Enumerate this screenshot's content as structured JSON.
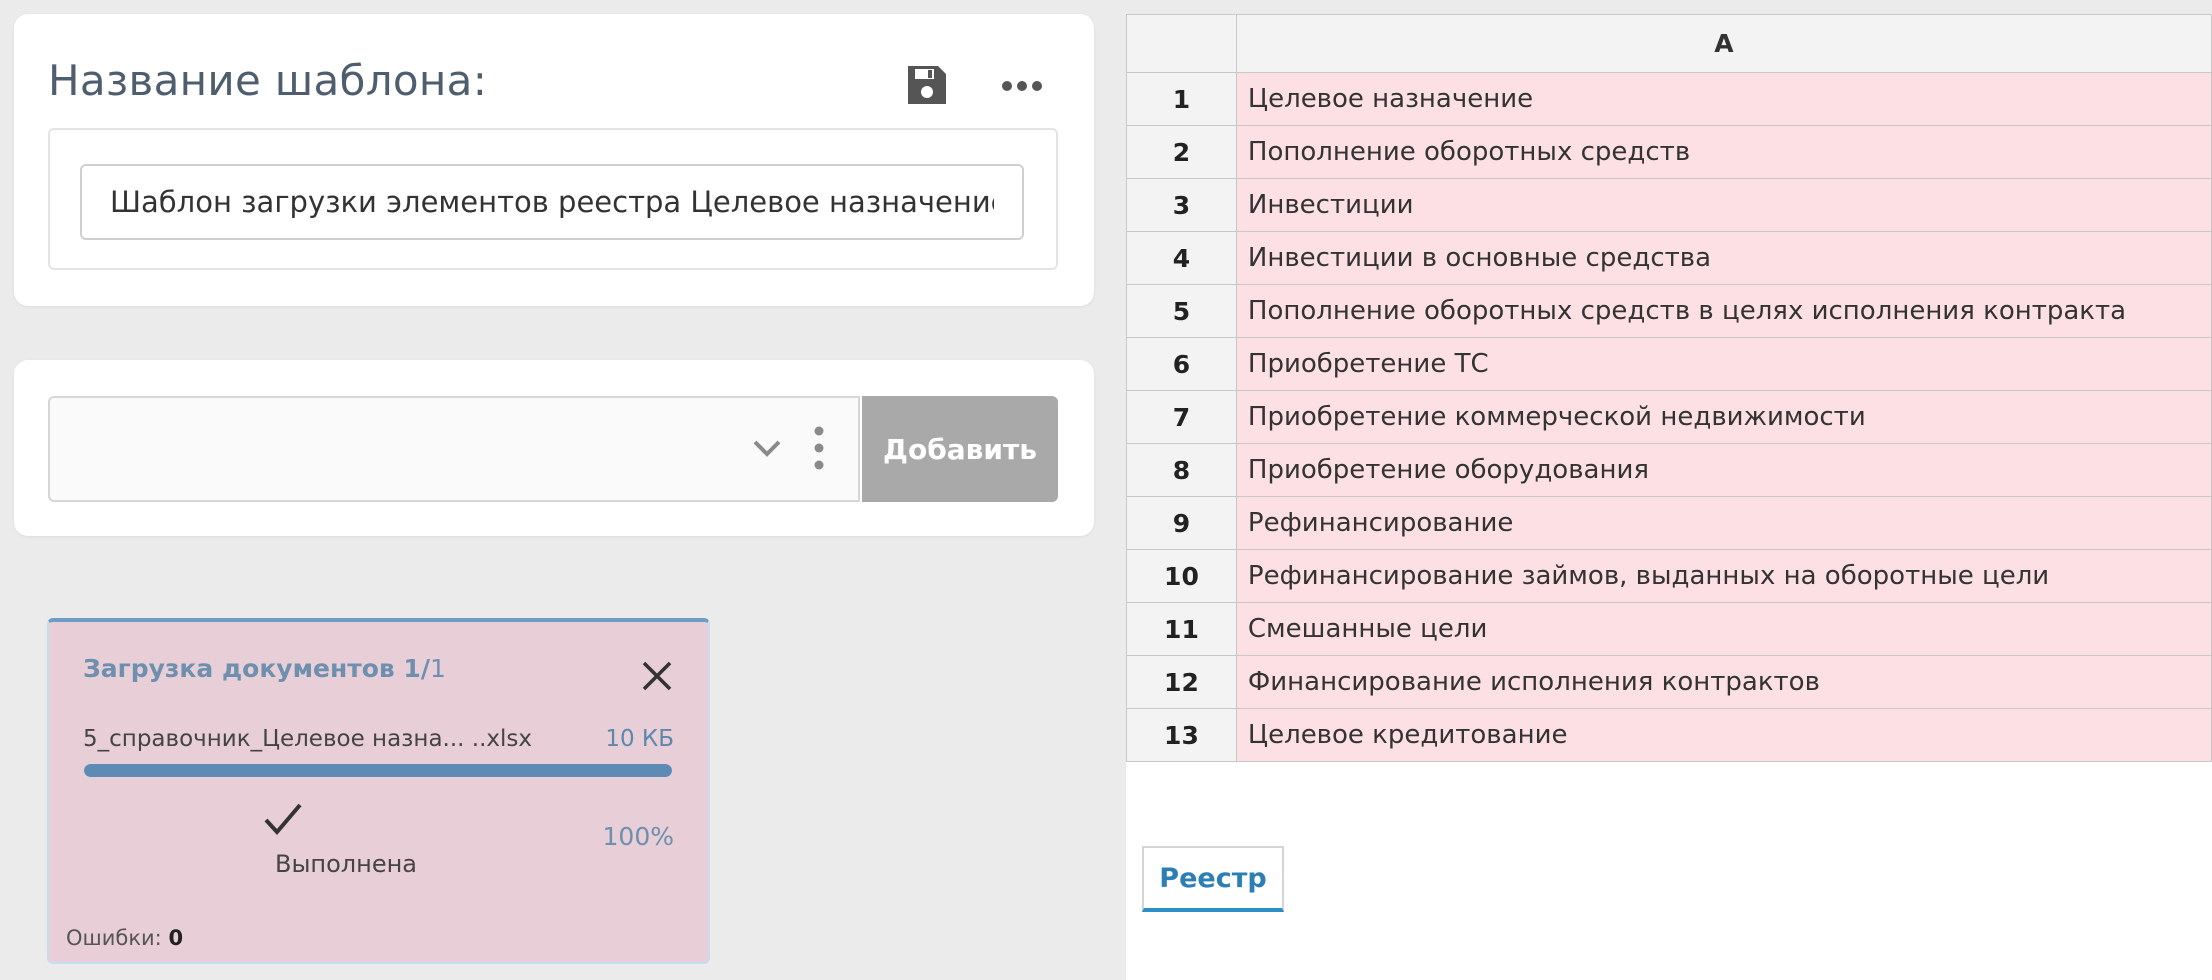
{
  "template": {
    "title": "Название шаблона:",
    "name_value": "Шаблон загрузки элементов реестра Целевое назначение"
  },
  "add_panel": {
    "select_value": "",
    "add_label": "Добавить"
  },
  "upload": {
    "title": "Загрузка документов 1/",
    "count": "1",
    "file_name": "5_справочник_Целевое назна... ..xlsx",
    "file_size": "10 КБ",
    "progress_fraction": 1.0,
    "status": "Выполнена",
    "percent": "100%",
    "errors_label": "Ошибки:",
    "errors_value": "0"
  },
  "sheet": {
    "column_header": "A",
    "rows": [
      {
        "n": "1",
        "v": "Целевое назначение"
      },
      {
        "n": "2",
        "v": "Пополнение оборотных средств"
      },
      {
        "n": "3",
        "v": "Инвестиции"
      },
      {
        "n": "4",
        "v": "Инвестиции в основные средства"
      },
      {
        "n": "5",
        "v": "Пополнение оборотных средств в целях исполнения контракта"
      },
      {
        "n": "6",
        "v": "Приобретение ТС"
      },
      {
        "n": "7",
        "v": "Приобретение коммерческой недвижимости"
      },
      {
        "n": "8",
        "v": "Приобретение оборудования"
      },
      {
        "n": "9",
        "v": "Рефинансирование"
      },
      {
        "n": "10",
        "v": "Рефинансирование займов, выданных на оборотные цели"
      },
      {
        "n": "11",
        "v": "Смешанные цели"
      },
      {
        "n": "12",
        "v": "Финансирование исполнения контрактов"
      },
      {
        "n": "13",
        "v": "Целевое кредитование"
      }
    ],
    "tab_label": "Реестр"
  },
  "colors": {
    "row_fill": "#fde0e3",
    "upload_bg": "#e8ced6",
    "accent": "#2b8ec5",
    "add_button": "#a9a9a9"
  }
}
